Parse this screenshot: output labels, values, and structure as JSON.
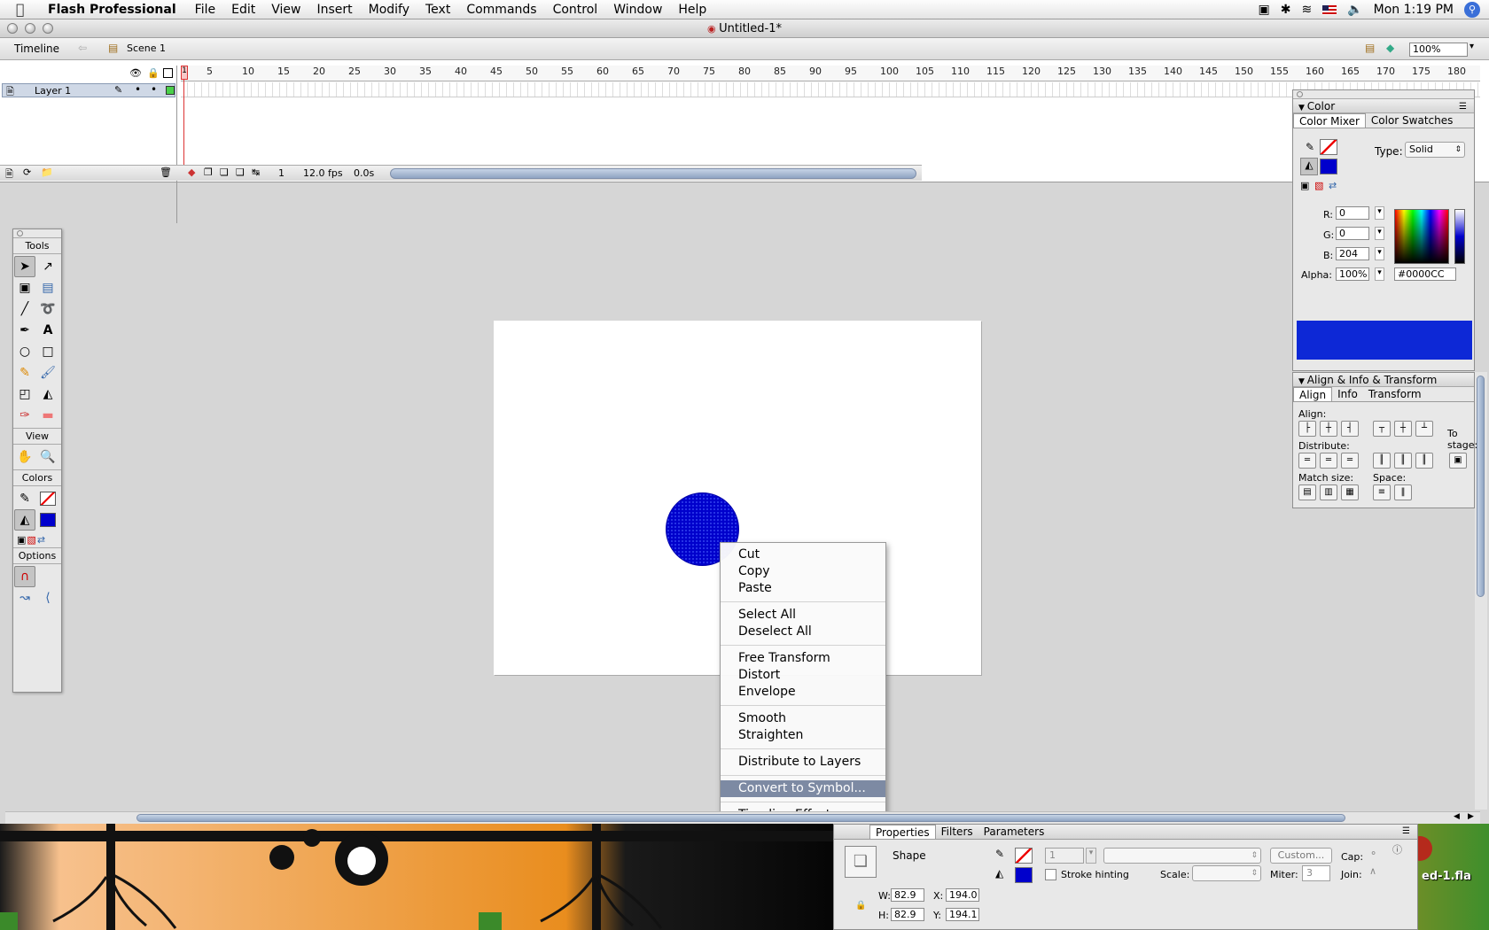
{
  "menubar": {
    "app_name": "Flash Professional",
    "items": [
      "File",
      "Edit",
      "View",
      "Insert",
      "Modify",
      "Text",
      "Commands",
      "Control",
      "Window",
      "Help"
    ],
    "clock": "Mon 1:19 PM"
  },
  "window": {
    "title": "Untitled-1*"
  },
  "timeline_header": {
    "label": "Timeline",
    "scene": "Scene 1",
    "zoom": "100%"
  },
  "timeline": {
    "layer_name": "Layer 1",
    "ruler": [
      "1",
      "5",
      "10",
      "15",
      "20",
      "25",
      "30",
      "35",
      "40",
      "45",
      "50",
      "55",
      "60",
      "65",
      "70",
      "75",
      "80",
      "85",
      "90",
      "95",
      "100",
      "105",
      "110",
      "115",
      "120",
      "125",
      "130",
      "135",
      "140",
      "145",
      "150",
      "155",
      "160",
      "165",
      "170",
      "175",
      "180"
    ],
    "current_frame": "1",
    "fps": "12.0 fps",
    "elapsed": "0.0s"
  },
  "tools": {
    "title": "Tools",
    "view_label": "View",
    "colors_label": "Colors",
    "options_label": "Options"
  },
  "context_menu": {
    "items": [
      [
        "Cut",
        "Copy",
        "Paste"
      ],
      [
        "Select All",
        "Deselect All"
      ],
      [
        "Free Transform",
        "Distort",
        "Envelope"
      ],
      [
        "Smooth",
        "Straighten"
      ],
      [
        "Distribute to Layers"
      ],
      [
        "Convert to Symbol..."
      ],
      [
        "Timeline Effects"
      ]
    ],
    "selected": "Convert to Symbol..."
  },
  "color_panel": {
    "title": "Color",
    "tabs": [
      "Color Mixer",
      "Color Swatches"
    ],
    "type_label": "Type:",
    "type_value": "Solid",
    "r_label": "R:",
    "r": "0",
    "g_label": "G:",
    "g": "0",
    "b_label": "B:",
    "b": "204",
    "alpha_label": "Alpha:",
    "alpha": "100%",
    "hex": "#0000CC",
    "fill_color": "#0000cc"
  },
  "align_panel": {
    "title": "Align & Info & Transform",
    "tabs": [
      "Align",
      "Info",
      "Transform"
    ],
    "align_label": "Align:",
    "distribute_label": "Distribute:",
    "match_size_label": "Match size:",
    "space_label": "Space:",
    "to_stage_label": "To stage:"
  },
  "properties": {
    "tabs": [
      "Properties",
      "Filters",
      "Parameters"
    ],
    "kind": "Shape",
    "stroke_width": "1",
    "custom_button": "Custom...",
    "cap_label": "Cap:",
    "stroke_hinting_label": "Stroke hinting",
    "scale_label": "Scale:",
    "miter_label": "Miter:",
    "miter_value": "3",
    "join_label": "Join:",
    "w_label": "W:",
    "w": "82.9",
    "h_label": "H:",
    "h": "82.9",
    "x_label": "X:",
    "x": "194.0",
    "y_label": "Y:",
    "y": "194.1"
  },
  "desktop": {
    "file_label": "ed-1.fla"
  }
}
